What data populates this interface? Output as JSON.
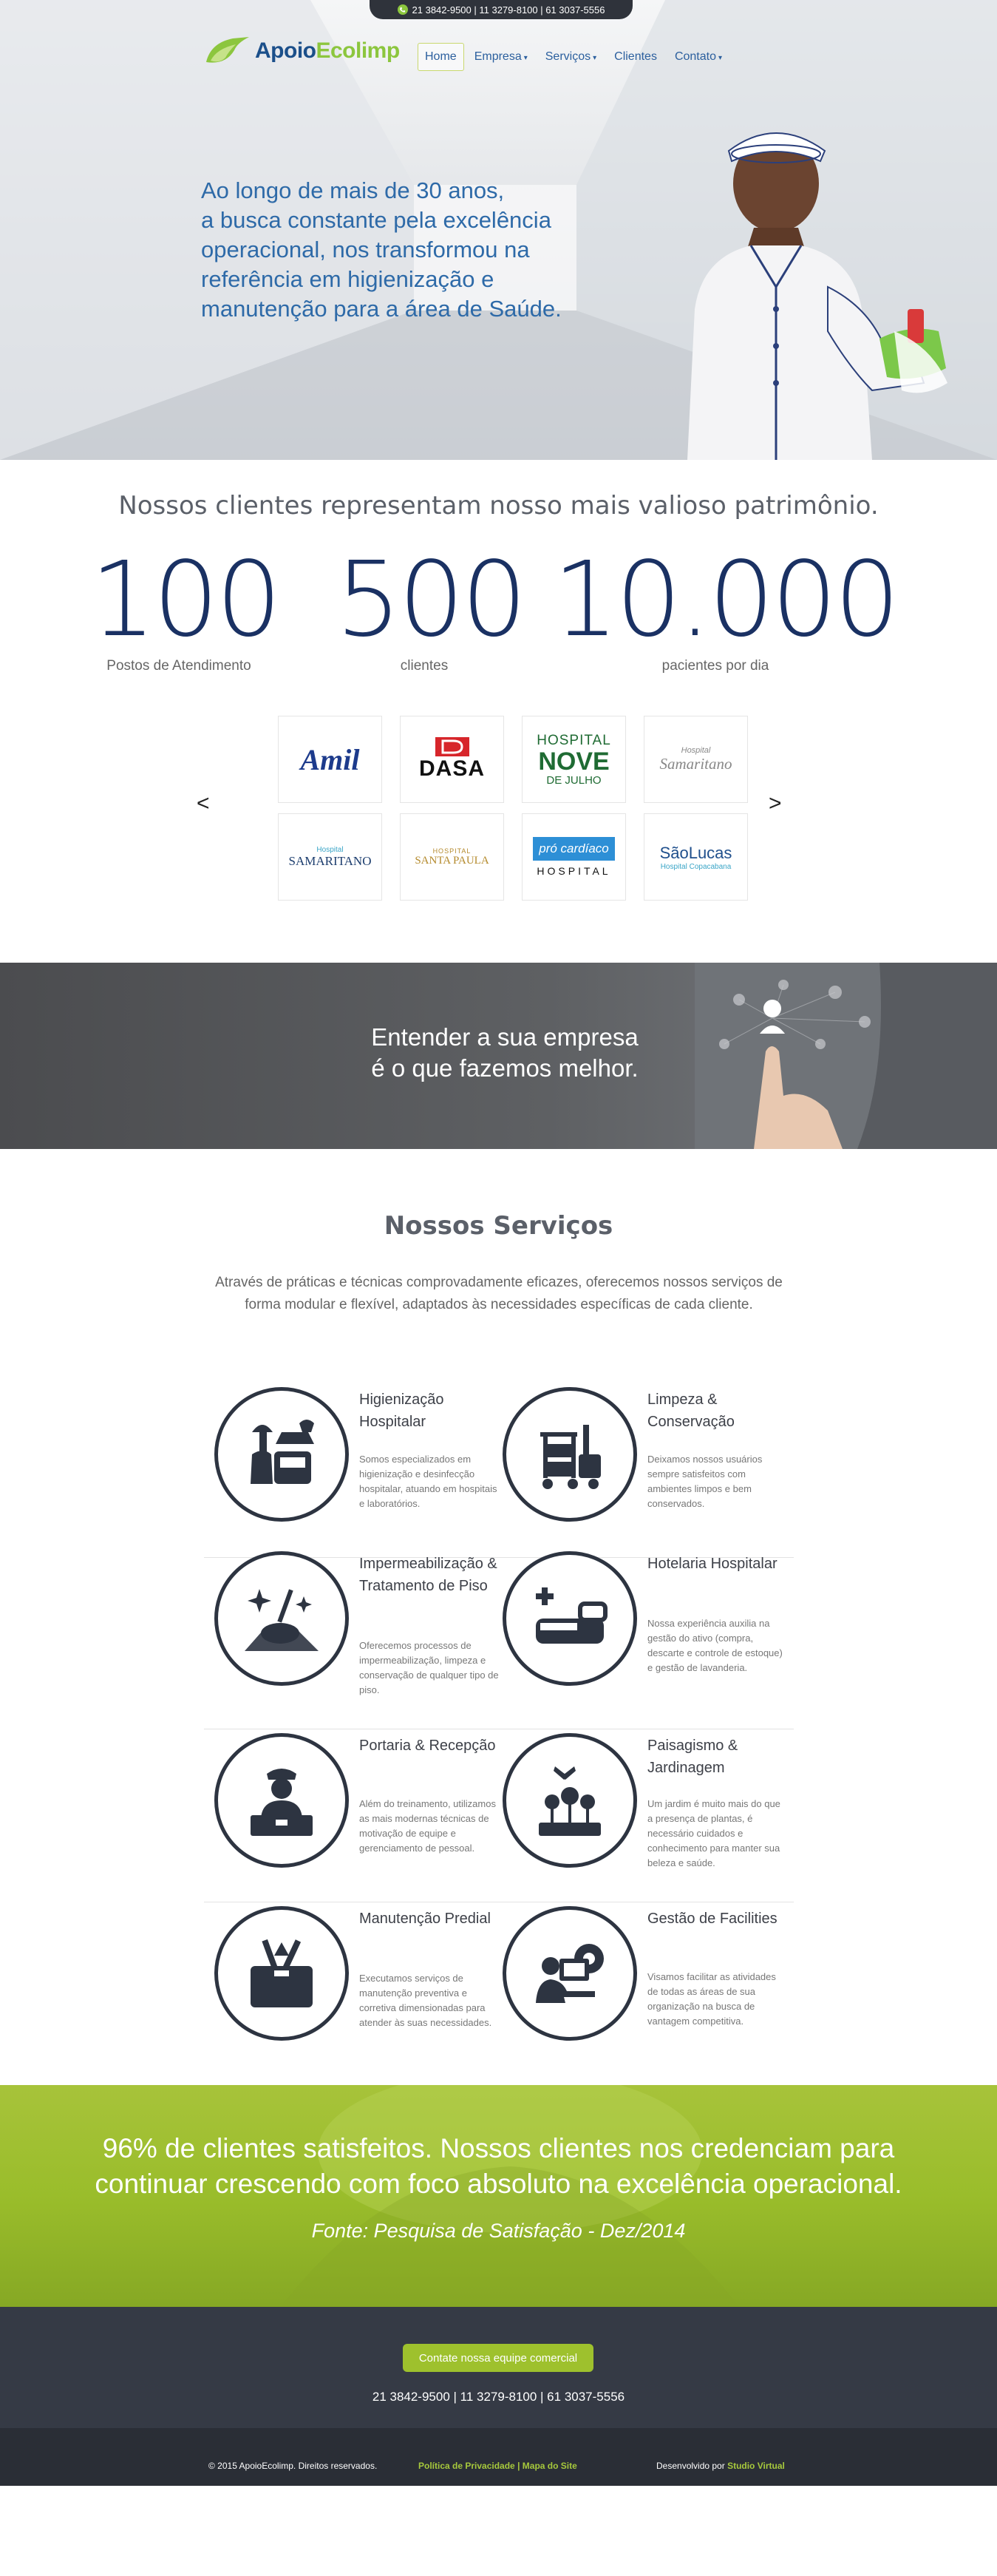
{
  "topbar": {
    "phones": "21 3842-9500 | 11 3279-8100 | 61 3037-5556"
  },
  "logo": {
    "part1": "Apoio",
    "part2": "Ecolimp"
  },
  "nav": {
    "items": [
      {
        "label": "Home",
        "dropdown": false
      },
      {
        "label": "Empresa",
        "dropdown": true
      },
      {
        "label": "Serviços",
        "dropdown": true
      },
      {
        "label": "Clientes",
        "dropdown": false
      },
      {
        "label": "Contato",
        "dropdown": true
      }
    ],
    "caret": "▾"
  },
  "hero": {
    "lines": [
      "Ao longo de mais de 30 anos,",
      "a busca constante pela excelência",
      "operacional, nos transformou na",
      "referência em higienização e",
      "manutenção para a área de Saúde."
    ]
  },
  "stats": {
    "title": "Nossos clientes representam nosso mais valioso patrimônio.",
    "items": [
      {
        "value": "100",
        "label": "Postos de Atendimento"
      },
      {
        "value": "500",
        "label": "clientes"
      },
      {
        "value": "10.000",
        "label": "pacientes por dia"
      }
    ],
    "prev": "<",
    "next": ">"
  },
  "clients": [
    {
      "name": "Amil"
    },
    {
      "name": "DASA"
    },
    {
      "name_top": "HOSPITAL",
      "name": "NOVE",
      "name_bottom": "DE JULHO"
    },
    {
      "name": "Samaritano",
      "sub": "Hospital"
    },
    {
      "name": "SAMARITANO",
      "sub": "Hospital"
    },
    {
      "name": "SANTA PAULA",
      "sub": "HOSPITAL"
    },
    {
      "name": "pró cardíaco",
      "sub": "HOSPITAL"
    },
    {
      "name": "SãoLucas",
      "sub": "Hospital Copacabana"
    }
  ],
  "banner": {
    "line1": "Entender a sua empresa",
    "line2": "é o que fazemos melhor."
  },
  "services": {
    "title": "Nossos Serviços",
    "description": "Através de práticas e técnicas comprovadamente eficazes, oferecemos nossos serviços de forma modular e flexível, adaptados às necessidades específicas de cada cliente.",
    "items": [
      {
        "title": "Higienização Hospitalar",
        "text": "Somos especializados em higienização e desinfecção hospitalar, atuando em hospitais e laboratórios.",
        "icon": "cleaning-kit-icon"
      },
      {
        "title": "Limpeza & Conservação",
        "text": "Deixamos nossos usuários sempre satisfeitos com ambientes limpos e bem conservados.",
        "icon": "cleaning-cart-icon"
      },
      {
        "title": "Impermeabilização & Tratamento de Piso",
        "text": "Oferecemos processos de impermeabilização, limpeza e conservação de qualquer tipo de piso.",
        "icon": "floor-polisher-icon"
      },
      {
        "title": "Hotelaria Hospitalar",
        "text": "Nossa experiência auxilia na gestão do ativo (compra, descarte e controle de estoque) e gestão de lavanderia.",
        "icon": "hospital-bed-icon"
      },
      {
        "title": "Portaria & Recepção",
        "text": "Além do treinamento, utilizamos as mais modernas técnicas de motivação de equipe e gerenciamento de pessoal.",
        "icon": "receptionist-icon"
      },
      {
        "title": "Paisagismo & Jardinagem",
        "text": "Um jardim é muito mais do que a presença de plantas, é necessário cuidados e conhecimento para manter sua beleza e saúde.",
        "icon": "garden-icon"
      },
      {
        "title": "Manutenção Predial",
        "text": "Executamos serviços de manutenção preventiva e corretiva dimensionadas para atender às suas necessidades.",
        "icon": "toolbox-icon"
      },
      {
        "title": "Gestão de Facilities",
        "text": "Visamos facilitar as atividades de todas as áreas de sua organização na busca de vantagem competitiva.",
        "icon": "facilities-manager-icon"
      }
    ]
  },
  "satisfaction": {
    "line1": "96% de clientes satisfeitos. Nossos clientes nos credenciam para",
    "line2": "continuar crescendo com foco absoluto na excelência operacional.",
    "source": "Fonte: Pesquisa de Satisfação - Dez/2014"
  },
  "contact": {
    "button": "Contate nossa equipe comercial",
    "phones": "21 3842-9500 | 11 3279-8100 | 61 3037-5556"
  },
  "footer": {
    "copyright": "© 2015 ApoioEcolimp. Direitos reservados.",
    "privacy": "Política de Privacidade",
    "separator": "|",
    "sitemap": "Mapa do Site",
    "developed_by": "Desenvolvido por",
    "developer": "Studio Virtual"
  },
  "colors": {
    "brand_blue": "#1a3163",
    "brand_green": "#9ec12d",
    "dark": "#353a45"
  }
}
